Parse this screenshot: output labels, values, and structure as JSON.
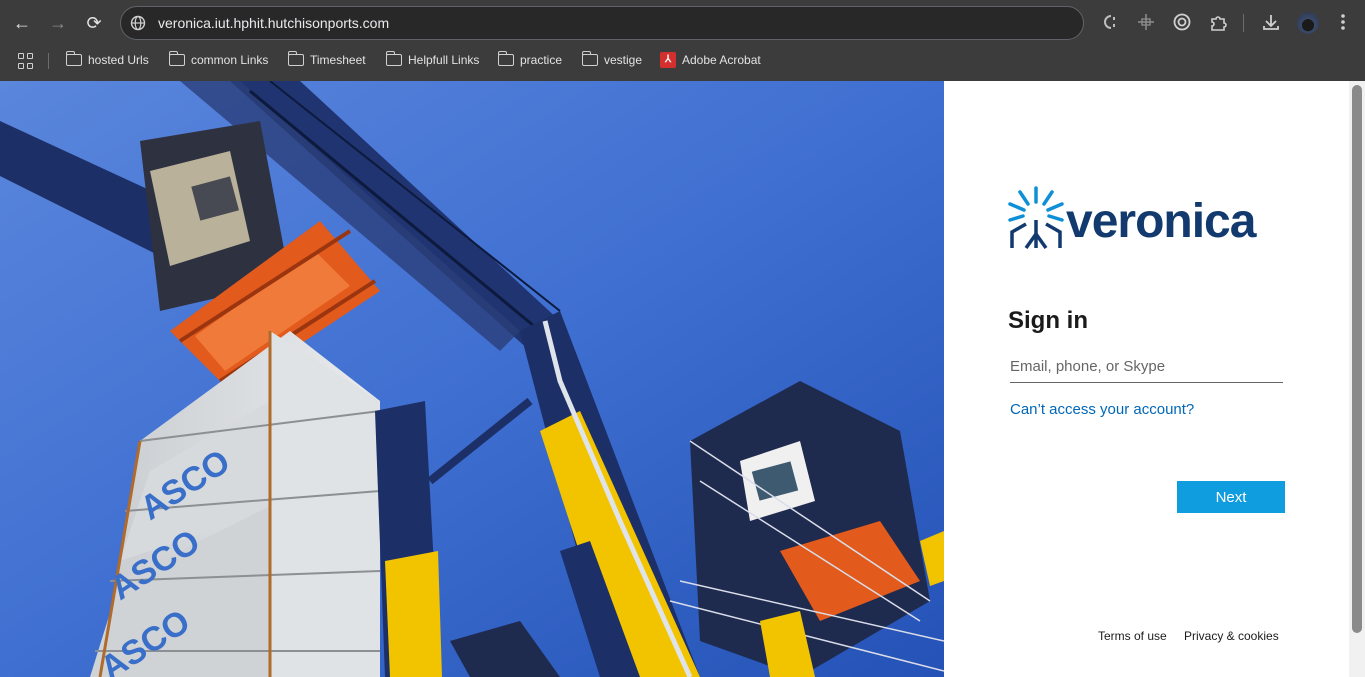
{
  "browser": {
    "url": "veronica.iut.hphit.hutchisonports.com",
    "nav": {
      "back_icon": "←",
      "forward_icon": "→",
      "reload_icon": "⟳"
    },
    "toolbar_icons": [
      "reader-mode-icon",
      "cast-icon",
      "screenshot-icon",
      "extensions-icon",
      "downloads-icon",
      "profile-avatar",
      "menu-icon"
    ]
  },
  "bookmarks": {
    "items": [
      {
        "label": "hosted Urls",
        "icon": "folder-icon"
      },
      {
        "label": "common Links",
        "icon": "folder-icon"
      },
      {
        "label": "Timesheet",
        "icon": "folder-icon"
      },
      {
        "label": "Helpfull Links",
        "icon": "folder-icon"
      },
      {
        "label": "practice",
        "icon": "folder-icon"
      },
      {
        "label": "vestige",
        "icon": "folder-icon"
      },
      {
        "label": "Adobe Acrobat",
        "icon": "pdf-icon"
      }
    ]
  },
  "signin": {
    "brand": "veronica",
    "title": "Sign in",
    "email_placeholder": "Email, phone, or Skype",
    "email_value": "",
    "cant_access": "Can’t access your account?",
    "next_label": "Next",
    "footer": {
      "terms": "Terms of use",
      "privacy": "Privacy & cookies"
    }
  },
  "colors": {
    "brand_navy": "#123a6e",
    "brand_sky": "#0f8fd6",
    "button_blue": "#0f9de0",
    "link_blue": "#0067b8",
    "crane_yellow": "#f2c400",
    "crane_navy": "#1c2f66",
    "spreader_orange": "#e25a1c"
  }
}
